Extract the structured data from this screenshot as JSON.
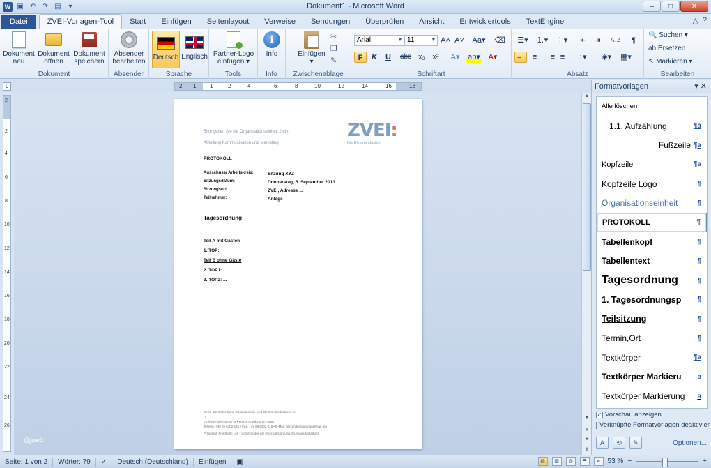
{
  "window": {
    "title": "Dokument1 - Microsoft Word",
    "min": "–",
    "max": "□",
    "close": "✕"
  },
  "qat": {
    "logo": "W",
    "save": "▣",
    "undo": "↶",
    "redo": "↷",
    "print": "▤",
    "more": "▾"
  },
  "tabs": [
    {
      "label": "Datei"
    },
    {
      "label": "ZVEI-Vorlagen-Tool"
    },
    {
      "label": "Start"
    },
    {
      "label": "Einfügen"
    },
    {
      "label": "Seitenlayout"
    },
    {
      "label": "Verweise"
    },
    {
      "label": "Sendungen"
    },
    {
      "label": "Überprüfen"
    },
    {
      "label": "Ansicht"
    },
    {
      "label": "Entwicklertools"
    },
    {
      "label": "TextEngine"
    }
  ],
  "tab_right": {
    "help": "?",
    "collapse": "△"
  },
  "ribbon": {
    "dokument": {
      "label": "Dokument",
      "neu": "Dokument neu",
      "oeffnen": "Dokument öffnen",
      "speichern": "Dokument speichern"
    },
    "absender": {
      "label": "Absender",
      "bearbeiten": "Absender bearbeiten"
    },
    "sprache": {
      "label": "Sprache",
      "deutsch": "Deutsch",
      "englisch": "Englisch"
    },
    "tools": {
      "label": "Tools",
      "partner": "Partner-Logo einfügen ▾"
    },
    "info": {
      "label": "Info",
      "info": "Info"
    },
    "zwischenablage": {
      "label": "Zwischenablage",
      "einfuegen": "Einfügen",
      "arrow": "▾"
    },
    "schriftart": {
      "label": "Schriftart",
      "font": "Arial",
      "size": "11",
      "bold": "F",
      "italic": "K",
      "underline": "U",
      "strike": "abc",
      "sub": "x₂",
      "sup": "x²",
      "grow": "A˄",
      "shrink": "A˅",
      "case": "Aa▾",
      "clear": "⌫",
      "effects": "A▾",
      "highlight": "ab▾",
      "color": "A▾"
    },
    "absatz": {
      "label": "Absatz",
      "bullets": "☰▾",
      "numbers": "⒈▾",
      "multilevel": "⋮▾",
      "outdent": "⇤",
      "indent": "⇥",
      "sort": "A↓Z",
      "pilcrow": "¶",
      "left": "≡",
      "center": "≡",
      "right": "≡",
      "justify": "≡",
      "spacing": "↕▾",
      "shading": "◈▾",
      "border": "▦▾"
    },
    "bearbeiten": {
      "label": "Bearbeiten",
      "suchen": "Suchen ▾",
      "ersetzen": "Ersetzen",
      "markieren": "Markieren ▾"
    }
  },
  "ruler": {
    "ticks": [
      "2",
      "1",
      "1",
      "2",
      "4",
      "6",
      "8",
      "10",
      "12",
      "14",
      "16",
      "18"
    ],
    "corner": "L"
  },
  "vruler": {
    "ticks": [
      "2",
      "2",
      "4",
      "6",
      "8",
      "10",
      "12",
      "14",
      "16",
      "18",
      "20",
      "22",
      "24",
      "26"
    ]
  },
  "document": {
    "header_line1": "Bitte geben Sie die Organisationseinheit 2 ein.",
    "header_line2": "Abteilung Kommunikation und Marketing",
    "logo_main": "ZVEI",
    "logo_colon": ":",
    "logo_sub": "Die Elektroindustrie",
    "protokoll": "PROTOKOLL",
    "meta": [
      {
        "label": "Ausschuss/ Arbeitskreis:",
        "value": "Sitzung XYZ"
      },
      {
        "label": "Sitzungsdatum:",
        "value": "Donnerstag, 5. September 2013"
      },
      {
        "label": "Sitzungsort",
        "value": "ZVEI, Adresse ..."
      },
      {
        "label": "Teilnehmer:",
        "value": "Anlage"
      }
    ],
    "tagesordnung": "Tagesordnung",
    "teil_a": "Teil A mit Gästen",
    "top1": "1.   TOP:",
    "teil_b": "Teil B ohne Gäste",
    "top2": "2.   TOP1: ...",
    "top3": "3.   TOP2: ...",
    "footer": [
      "ZVEI - Zentralverband Elektrotechnik- und Elektronikindustrie e. V.",
      "IT",
      "Emil-von-Behring-Str. 4 • 60439 Frankfurt am Main",
      "Telefon: +49 69 6302-135 • Fax: +49 69 6302-118 • E-Mail: alexander.quednau@zvei.org",
      "Präsident: Friedhelm Loh • Vorsitzender der Geschäftsführung: Dr. Klaus Mittelbach"
    ]
  },
  "watermark": "@jweb",
  "pane": {
    "title": "Formatvorlagen",
    "controls": "▾ ✕",
    "items": [
      {
        "name": "Alle löschen",
        "sym": ""
      },
      {
        "name": "1.1.  Aufzählung",
        "sym": "¶a"
      },
      {
        "name": "Fußzeile",
        "sym": "¶a"
      },
      {
        "name": "Kopfzeile",
        "sym": "¶a"
      },
      {
        "name": "Kopfzeile Logo",
        "sym": "¶"
      },
      {
        "name": "Organisationseinheit",
        "sym": "¶"
      },
      {
        "name": "PROTOKOLL",
        "sym": "¶"
      },
      {
        "name": "Tabellenkopf",
        "sym": "¶"
      },
      {
        "name": "Tabellentext",
        "sym": "¶"
      },
      {
        "name": "Tagesordnung",
        "sym": "¶"
      },
      {
        "name": "1.  Tagesordnungsp",
        "sym": "¶"
      },
      {
        "name": "Teilsitzung",
        "sym": "¶"
      },
      {
        "name": "Termin,Ort",
        "sym": "¶"
      },
      {
        "name": "Textkörper",
        "sym": "¶a"
      },
      {
        "name": "Textkörper Markieru",
        "sym": "a"
      },
      {
        "name": "Textkörper Markierung",
        "sym": "a"
      }
    ],
    "vorschau": "Vorschau anzeigen",
    "vorschau_check": "✓",
    "verknuepft": "Verknüpfte Formatvorlagen deaktivieren",
    "optionen": "Optionen...",
    "btn1": "A",
    "btn2": "⟲",
    "btn3": "✎"
  },
  "status": {
    "seite": "Seite: 1 von 2",
    "woerter": "Wörter: 79",
    "lang": "Deutsch (Deutschland)",
    "mode": "Einfügen",
    "zoom": "53 %",
    "minus": "−",
    "plus": "+"
  }
}
